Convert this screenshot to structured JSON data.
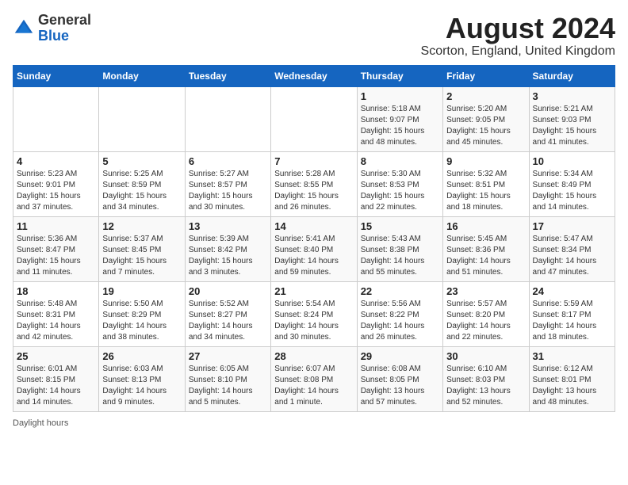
{
  "header": {
    "logo_general": "General",
    "logo_blue": "Blue",
    "title": "August 2024",
    "subtitle": "Scorton, England, United Kingdom"
  },
  "calendar": {
    "days_of_week": [
      "Sunday",
      "Monday",
      "Tuesday",
      "Wednesday",
      "Thursday",
      "Friday",
      "Saturday"
    ],
    "weeks": [
      [
        {
          "day": "",
          "info": ""
        },
        {
          "day": "",
          "info": ""
        },
        {
          "day": "",
          "info": ""
        },
        {
          "day": "",
          "info": ""
        },
        {
          "day": "1",
          "info": "Sunrise: 5:18 AM\nSunset: 9:07 PM\nDaylight: 15 hours\nand 48 minutes."
        },
        {
          "day": "2",
          "info": "Sunrise: 5:20 AM\nSunset: 9:05 PM\nDaylight: 15 hours\nand 45 minutes."
        },
        {
          "day": "3",
          "info": "Sunrise: 5:21 AM\nSunset: 9:03 PM\nDaylight: 15 hours\nand 41 minutes."
        }
      ],
      [
        {
          "day": "4",
          "info": "Sunrise: 5:23 AM\nSunset: 9:01 PM\nDaylight: 15 hours\nand 37 minutes."
        },
        {
          "day": "5",
          "info": "Sunrise: 5:25 AM\nSunset: 8:59 PM\nDaylight: 15 hours\nand 34 minutes."
        },
        {
          "day": "6",
          "info": "Sunrise: 5:27 AM\nSunset: 8:57 PM\nDaylight: 15 hours\nand 30 minutes."
        },
        {
          "day": "7",
          "info": "Sunrise: 5:28 AM\nSunset: 8:55 PM\nDaylight: 15 hours\nand 26 minutes."
        },
        {
          "day": "8",
          "info": "Sunrise: 5:30 AM\nSunset: 8:53 PM\nDaylight: 15 hours\nand 22 minutes."
        },
        {
          "day": "9",
          "info": "Sunrise: 5:32 AM\nSunset: 8:51 PM\nDaylight: 15 hours\nand 18 minutes."
        },
        {
          "day": "10",
          "info": "Sunrise: 5:34 AM\nSunset: 8:49 PM\nDaylight: 15 hours\nand 14 minutes."
        }
      ],
      [
        {
          "day": "11",
          "info": "Sunrise: 5:36 AM\nSunset: 8:47 PM\nDaylight: 15 hours\nand 11 minutes."
        },
        {
          "day": "12",
          "info": "Sunrise: 5:37 AM\nSunset: 8:45 PM\nDaylight: 15 hours\nand 7 minutes."
        },
        {
          "day": "13",
          "info": "Sunrise: 5:39 AM\nSunset: 8:42 PM\nDaylight: 15 hours\nand 3 minutes."
        },
        {
          "day": "14",
          "info": "Sunrise: 5:41 AM\nSunset: 8:40 PM\nDaylight: 14 hours\nand 59 minutes."
        },
        {
          "day": "15",
          "info": "Sunrise: 5:43 AM\nSunset: 8:38 PM\nDaylight: 14 hours\nand 55 minutes."
        },
        {
          "day": "16",
          "info": "Sunrise: 5:45 AM\nSunset: 8:36 PM\nDaylight: 14 hours\nand 51 minutes."
        },
        {
          "day": "17",
          "info": "Sunrise: 5:47 AM\nSunset: 8:34 PM\nDaylight: 14 hours\nand 47 minutes."
        }
      ],
      [
        {
          "day": "18",
          "info": "Sunrise: 5:48 AM\nSunset: 8:31 PM\nDaylight: 14 hours\nand 42 minutes."
        },
        {
          "day": "19",
          "info": "Sunrise: 5:50 AM\nSunset: 8:29 PM\nDaylight: 14 hours\nand 38 minutes."
        },
        {
          "day": "20",
          "info": "Sunrise: 5:52 AM\nSunset: 8:27 PM\nDaylight: 14 hours\nand 34 minutes."
        },
        {
          "day": "21",
          "info": "Sunrise: 5:54 AM\nSunset: 8:24 PM\nDaylight: 14 hours\nand 30 minutes."
        },
        {
          "day": "22",
          "info": "Sunrise: 5:56 AM\nSunset: 8:22 PM\nDaylight: 14 hours\nand 26 minutes."
        },
        {
          "day": "23",
          "info": "Sunrise: 5:57 AM\nSunset: 8:20 PM\nDaylight: 14 hours\nand 22 minutes."
        },
        {
          "day": "24",
          "info": "Sunrise: 5:59 AM\nSunset: 8:17 PM\nDaylight: 14 hours\nand 18 minutes."
        }
      ],
      [
        {
          "day": "25",
          "info": "Sunrise: 6:01 AM\nSunset: 8:15 PM\nDaylight: 14 hours\nand 14 minutes."
        },
        {
          "day": "26",
          "info": "Sunrise: 6:03 AM\nSunset: 8:13 PM\nDaylight: 14 hours\nand 9 minutes."
        },
        {
          "day": "27",
          "info": "Sunrise: 6:05 AM\nSunset: 8:10 PM\nDaylight: 14 hours\nand 5 minutes."
        },
        {
          "day": "28",
          "info": "Sunrise: 6:07 AM\nSunset: 8:08 PM\nDaylight: 14 hours\nand 1 minute."
        },
        {
          "day": "29",
          "info": "Sunrise: 6:08 AM\nSunset: 8:05 PM\nDaylight: 13 hours\nand 57 minutes."
        },
        {
          "day": "30",
          "info": "Sunrise: 6:10 AM\nSunset: 8:03 PM\nDaylight: 13 hours\nand 52 minutes."
        },
        {
          "day": "31",
          "info": "Sunrise: 6:12 AM\nSunset: 8:01 PM\nDaylight: 13 hours\nand 48 minutes."
        }
      ]
    ]
  },
  "footer": {
    "daylight_hours": "Daylight hours"
  }
}
